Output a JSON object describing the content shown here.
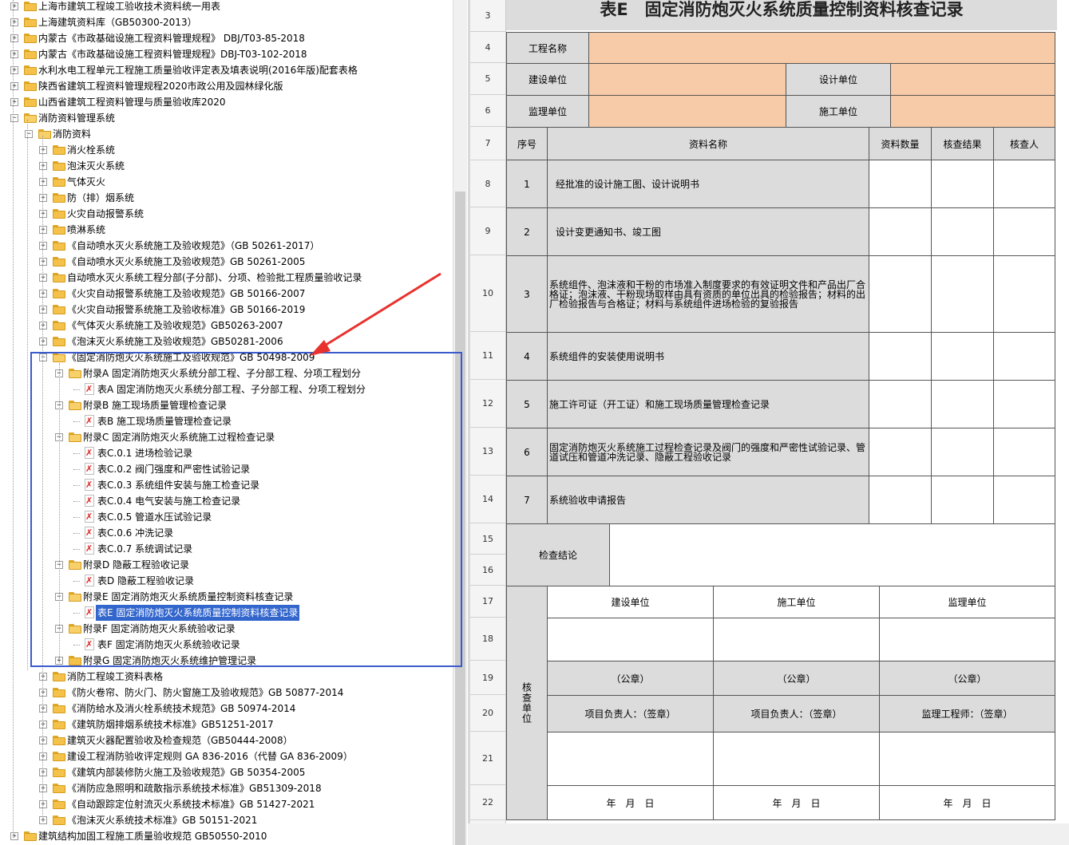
{
  "tree": {
    "rows": [
      {
        "label": "上海市建筑工程竣工验收技术资料统一用表",
        "level": 0,
        "kind": "folder",
        "exp": "+"
      },
      {
        "label": "上海建筑资料库（GB50300-2013）",
        "level": 0,
        "kind": "folder",
        "exp": "+"
      },
      {
        "label": "内蒙古《市政基础设施工程资料管理规程》 DBJ/T03-85-2018",
        "level": 0,
        "kind": "folder",
        "exp": "+"
      },
      {
        "label": "内蒙古《市政基础设施工程资料管理规程》DBJ-T03-102-2018",
        "level": 0,
        "kind": "folder",
        "exp": "+"
      },
      {
        "label": "水利水电工程单元工程施工质量验收评定表及填表说明(2016年版)配套表格",
        "level": 0,
        "kind": "folder",
        "exp": "+"
      },
      {
        "label": "陕西省建筑工程资料管理规程2020市政公用及园林绿化版",
        "level": 0,
        "kind": "folder",
        "exp": "+"
      },
      {
        "label": "山西省建筑工程资料管理与质量验收库2020",
        "level": 0,
        "kind": "folder",
        "exp": "+"
      },
      {
        "label": "消防资料管理系统",
        "level": 0,
        "kind": "folder-open",
        "exp": "−"
      },
      {
        "label": "消防资料",
        "level": 1,
        "kind": "folder-open",
        "exp": "−"
      },
      {
        "label": "消火栓系统",
        "level": 2,
        "kind": "folder",
        "exp": "+"
      },
      {
        "label": "泡沫灭火系统",
        "level": 2,
        "kind": "folder",
        "exp": "+"
      },
      {
        "label": "气体灭火",
        "level": 2,
        "kind": "folder",
        "exp": "+"
      },
      {
        "label": "防（排）烟系统",
        "level": 2,
        "kind": "folder",
        "exp": "+"
      },
      {
        "label": "火灾自动报警系统",
        "level": 2,
        "kind": "folder",
        "exp": "+"
      },
      {
        "label": "喷淋系统",
        "level": 2,
        "kind": "folder",
        "exp": "+"
      },
      {
        "label": "《自动喷水灭火系统施工及验收规范》（GB 50261-2017）",
        "level": 2,
        "kind": "folder",
        "exp": "+"
      },
      {
        "label": "《自动喷水灭火系统施工及验收规范》GB 50261-2005",
        "level": 2,
        "kind": "folder",
        "exp": "+"
      },
      {
        "label": "自动喷水灭火系统工程分部(子分部)、分项、检验批工程质量验收记录",
        "level": 2,
        "kind": "folder",
        "exp": "+"
      },
      {
        "label": "《火灾自动报警系统施工及验收规范》GB 50166-2007",
        "level": 2,
        "kind": "folder",
        "exp": "+"
      },
      {
        "label": "《火灾自动报警系统施工及验收标准》GB 50166-2019",
        "level": 2,
        "kind": "folder",
        "exp": "+"
      },
      {
        "label": "《气体灭火系统施工及验收规范》GB50263-2007",
        "level": 2,
        "kind": "folder",
        "exp": "+"
      },
      {
        "label": "《泡沫灭火系统施工及验收规范》GB50281-2006",
        "level": 2,
        "kind": "folder",
        "exp": "+"
      },
      {
        "label": "《固定消防炮灭火系统施工及验收规范》GB 50498-2009",
        "level": 2,
        "kind": "folder-open",
        "exp": "−"
      },
      {
        "label": "附录A 固定消防炮灭火系统分部工程、子分部工程、分项工程划分",
        "level": 3,
        "kind": "folder-open",
        "exp": "−"
      },
      {
        "label": "表A 固定消防炮灭火系统分部工程、子分部工程、分项工程划分",
        "level": 4,
        "kind": "doc",
        "exp": ""
      },
      {
        "label": "附录B 施工现场质量管理检查记录",
        "level": 3,
        "kind": "folder-open",
        "exp": "−"
      },
      {
        "label": "表B 施工现场质量管理检查记录",
        "level": 4,
        "kind": "doc",
        "exp": ""
      },
      {
        "label": "附录C 固定消防炮灭火系统施工过程检查记录",
        "level": 3,
        "kind": "folder-open",
        "exp": "−"
      },
      {
        "label": "表C.0.1 进场检验记录",
        "level": 4,
        "kind": "doc",
        "exp": ""
      },
      {
        "label": "表C.0.2 阀门强度和严密性试验记录",
        "level": 4,
        "kind": "doc",
        "exp": ""
      },
      {
        "label": "表C.0.3 系统组件安装与施工检查记录",
        "level": 4,
        "kind": "doc",
        "exp": ""
      },
      {
        "label": "表C.0.4 电气安装与施工检查记录",
        "level": 4,
        "kind": "doc",
        "exp": ""
      },
      {
        "label": "表C.0.5 管道水压试验记录",
        "level": 4,
        "kind": "doc",
        "exp": ""
      },
      {
        "label": "表C.0.6 冲洗记录",
        "level": 4,
        "kind": "doc",
        "exp": ""
      },
      {
        "label": "表C.0.7 系统调试记录",
        "level": 4,
        "kind": "doc",
        "exp": ""
      },
      {
        "label": "附录D 隐蔽工程验收记录",
        "level": 3,
        "kind": "folder-open",
        "exp": "−"
      },
      {
        "label": "表D 隐蔽工程验收记录",
        "level": 4,
        "kind": "doc",
        "exp": ""
      },
      {
        "label": "附录E 固定消防炮灭火系统质量控制资料核查记录",
        "level": 3,
        "kind": "folder-open",
        "exp": "−"
      },
      {
        "label": "表E 固定消防炮灭火系统质量控制资料核查记录",
        "level": 4,
        "kind": "doc",
        "exp": "",
        "selected": true
      },
      {
        "label": "附录F 固定消防炮灭火系统验收记录",
        "level": 3,
        "kind": "folder-open",
        "exp": "−"
      },
      {
        "label": "表F 固定消防炮灭火系统验收记录",
        "level": 4,
        "kind": "doc",
        "exp": ""
      },
      {
        "label": "附录G 固定消防炮灭火系统维护管理记录",
        "level": 3,
        "kind": "folder",
        "exp": "+"
      },
      {
        "label": "消防工程竣工资料表格",
        "level": 2,
        "kind": "folder",
        "exp": "+"
      },
      {
        "label": "《防火卷帘、防火门、防火窗施工及验收规范》GB 50877-2014",
        "level": 2,
        "kind": "folder",
        "exp": "+"
      },
      {
        "label": "《消防给水及消火栓系统技术规范》GB 50974-2014",
        "level": 2,
        "kind": "folder",
        "exp": "+"
      },
      {
        "label": "《建筑防烟排烟系统技术标准》GB51251-2017",
        "level": 2,
        "kind": "folder",
        "exp": "+"
      },
      {
        "label": "建筑灭火器配置验收及检查规范（GB50444-2008）",
        "level": 2,
        "kind": "folder",
        "exp": "+"
      },
      {
        "label": "建设工程消防验收评定规则 GA 836-2016（代替 GA 836-2009）",
        "level": 2,
        "kind": "folder",
        "exp": "+"
      },
      {
        "label": "《建筑内部装修防火施工及验收规范》GB 50354-2005",
        "level": 2,
        "kind": "folder",
        "exp": "+"
      },
      {
        "label": "《消防应急照明和疏散指示系统技术标准》GB51309-2018",
        "level": 2,
        "kind": "folder",
        "exp": "+"
      },
      {
        "label": "《自动跟踪定位射流灭火系统技术标准》GB 51427-2021",
        "level": 2,
        "kind": "folder",
        "exp": "+"
      },
      {
        "label": "《泡沫灭火系统技术标准》GB 50151-2021",
        "level": 2,
        "kind": "folder",
        "exp": "+"
      },
      {
        "label": "建筑结构加固工程施工质量验收规范 GB50550-2010",
        "level": 0,
        "kind": "folder",
        "exp": "+"
      }
    ]
  },
  "sheet": {
    "title": "表E　固定消防炮灭火系统质量控制资料核查记录",
    "row_numbers": [
      "3",
      "4",
      "5",
      "6",
      "7",
      "8",
      "9",
      "10",
      "11",
      "12",
      "13",
      "14",
      "15",
      "16",
      "17",
      "18",
      "19",
      "20",
      "21",
      "22"
    ],
    "labels": {
      "project_name": "工程名称",
      "construction_unit": "建设单位",
      "design_unit": "设计单位",
      "supervision_unit": "监理单位",
      "contractor_unit": "施工单位",
      "col_no": "序号",
      "col_name": "资料名称",
      "col_qty": "资料数量",
      "col_result": "核查结果",
      "col_checker": "核查人",
      "conclusion": "检查结论",
      "check_units": "核查单位",
      "sign_construction": "建设单位",
      "sign_contractor": "施工单位",
      "sign_supervision": "监理单位",
      "seal": "（公章）",
      "pm_sign": "项目负责人：（签章）",
      "engineer_sign": "监理工程师：（签章）",
      "date": "年　月　日"
    },
    "items": [
      {
        "no": "1",
        "name": "经批准的设计施工图、设计说明书"
      },
      {
        "no": "2",
        "name": "设计变更通知书、竣工图"
      },
      {
        "no": "3",
        "name": "系统组件、泡沫液和干粉的市场准入制度要求的有效证明文件和产品出厂合格证；泡沫液、干粉现场取样由具有资质的单位出具的检验报告；材料的出厂检验报告与合格证；材料与系统组件进场检验的复验报告"
      },
      {
        "no": "4",
        "name": "系统组件的安装使用说明书"
      },
      {
        "no": "5",
        "name": "施工许可证（开工证）和施工现场质量管理检查记录"
      },
      {
        "no": "6",
        "name": "固定消防炮灭火系统施工过程检查记录及阀门的强度和严密性试验记录、管道试压和管道冲洗记录、隐蔽工程验收记录"
      },
      {
        "no": "7",
        "name": "系统验收申请报告"
      }
    ]
  }
}
